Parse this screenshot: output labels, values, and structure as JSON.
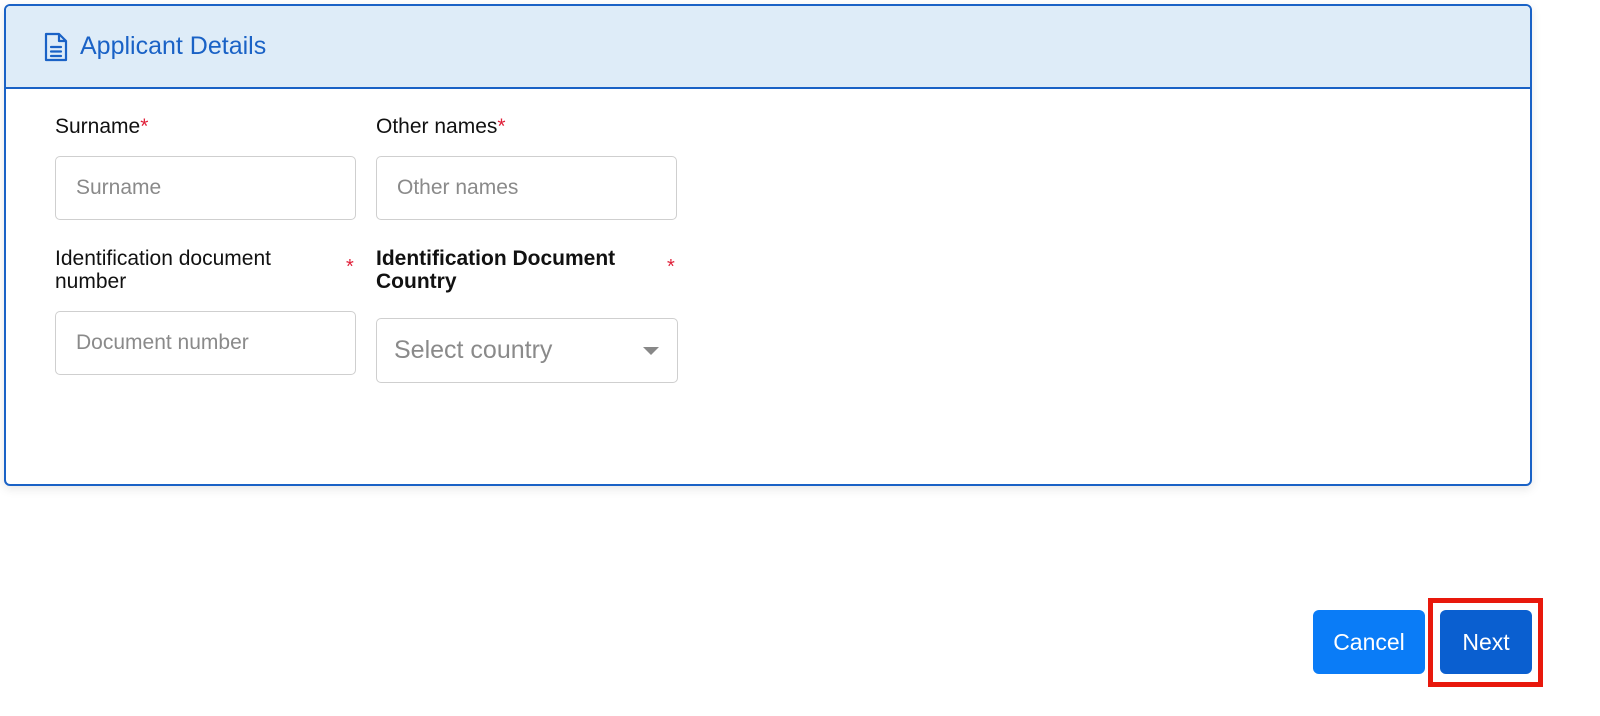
{
  "card": {
    "title": "Applicant Details",
    "icon": "document-icon",
    "accent_color": "#1a62c6",
    "header_bg": "#deecf8"
  },
  "fields": {
    "surname": {
      "label": "Surname",
      "required_mark": "*",
      "placeholder": "Surname",
      "value": ""
    },
    "other_names": {
      "label": "Other names",
      "required_mark": "*",
      "placeholder": "Other names",
      "value": ""
    },
    "id_doc_number": {
      "label_line1": "Identification document",
      "label_line2": "number",
      "required_mark": "*",
      "placeholder": "Document number",
      "value": ""
    },
    "id_doc_country": {
      "label_line1": "Identification Document",
      "label_line2": "Country",
      "required_mark": "*",
      "selected": "Select country"
    }
  },
  "actions": {
    "cancel_label": "Cancel",
    "next_label": "Next",
    "cancel_color": "#0a7cf7",
    "next_color": "#0a5fd0",
    "highlight_color": "#e8180c"
  }
}
